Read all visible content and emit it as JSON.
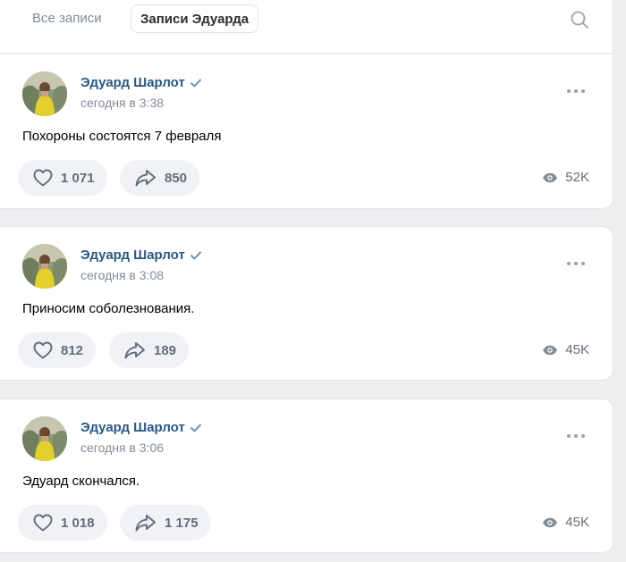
{
  "tabs": {
    "all_label": "Все записи",
    "own_label": "Записи Эдуарда"
  },
  "icons": {
    "search": "search-icon",
    "more": "more-icon",
    "like": "heart-icon",
    "share": "share-icon",
    "views": "eye-icon",
    "verified": "verified-icon"
  },
  "colors": {
    "author": "#2a5885",
    "muted": "#818c99",
    "pill_bg": "#f0f2f5",
    "verified": "#6d8fb4"
  },
  "posts": [
    {
      "author": "Эдуард Шарлот",
      "time": "сегодня в 3:38",
      "text": "Похороны состоятся 7 февраля",
      "likes": "1 071",
      "shares": "850",
      "views": "52K"
    },
    {
      "author": "Эдуард Шарлот",
      "time": "сегодня в 3:08",
      "text": "Приносим соболезнования.",
      "likes": "812",
      "shares": "189",
      "views": "45K"
    },
    {
      "author": "Эдуард Шарлот",
      "time": "сегодня в 3:06",
      "text": "Эдуард скончался.",
      "likes": "1 018",
      "shares": "1 175",
      "views": "45K"
    }
  ]
}
